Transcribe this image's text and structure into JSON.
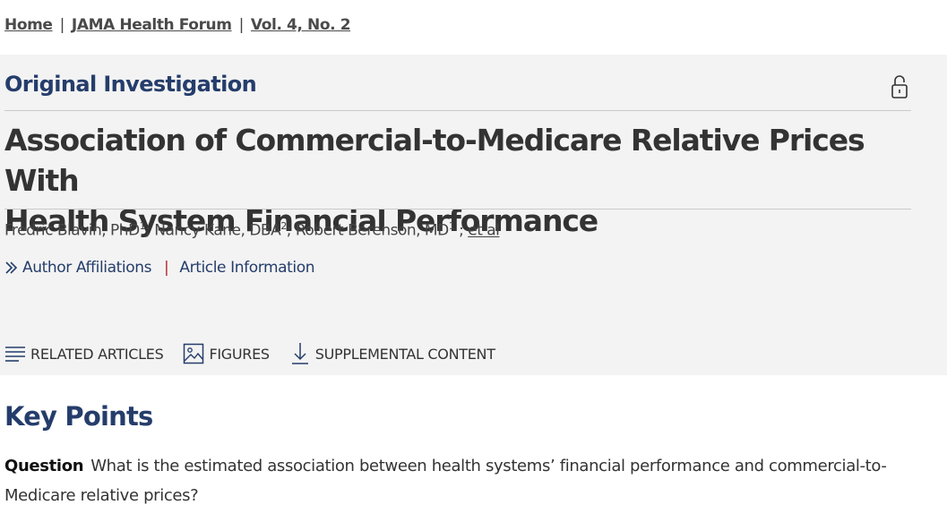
{
  "breadcrumb": {
    "home": "Home",
    "journal": "JAMA Health Forum",
    "issue": "Vol. 4, No. 2",
    "separator": "|"
  },
  "article": {
    "type": "Original Investigation",
    "title_line1": "Association of Commercial-to-Medicare Relative Prices With",
    "title_line2": "Health System Financial Performance",
    "authors": [
      {
        "name": "Fredric Blavin, PhD",
        "sup": "1"
      },
      {
        "name": "Nancy Kane, DBA",
        "sup": "2"
      },
      {
        "name": "Robert Berenson, MD",
        "sup": "1"
      }
    ],
    "et_al": "et al",
    "author_affiliations": "Author Affiliations",
    "article_information": "Article Information",
    "pipe": "|"
  },
  "tools": {
    "related": "RELATED ARTICLES",
    "figures": "FIGURES",
    "supplemental": "SUPPLEMENTAL CONTENT"
  },
  "key_points": {
    "heading": "Key Points",
    "question_label": "Question",
    "question_text": "What is the estimated association between health systems’ financial performance and commercial-to-Medicare relative prices?"
  },
  "colors": {
    "navy": "#253d6b",
    "panel_bg": "#f3f3f3",
    "pipe_red": "#b4272f"
  }
}
